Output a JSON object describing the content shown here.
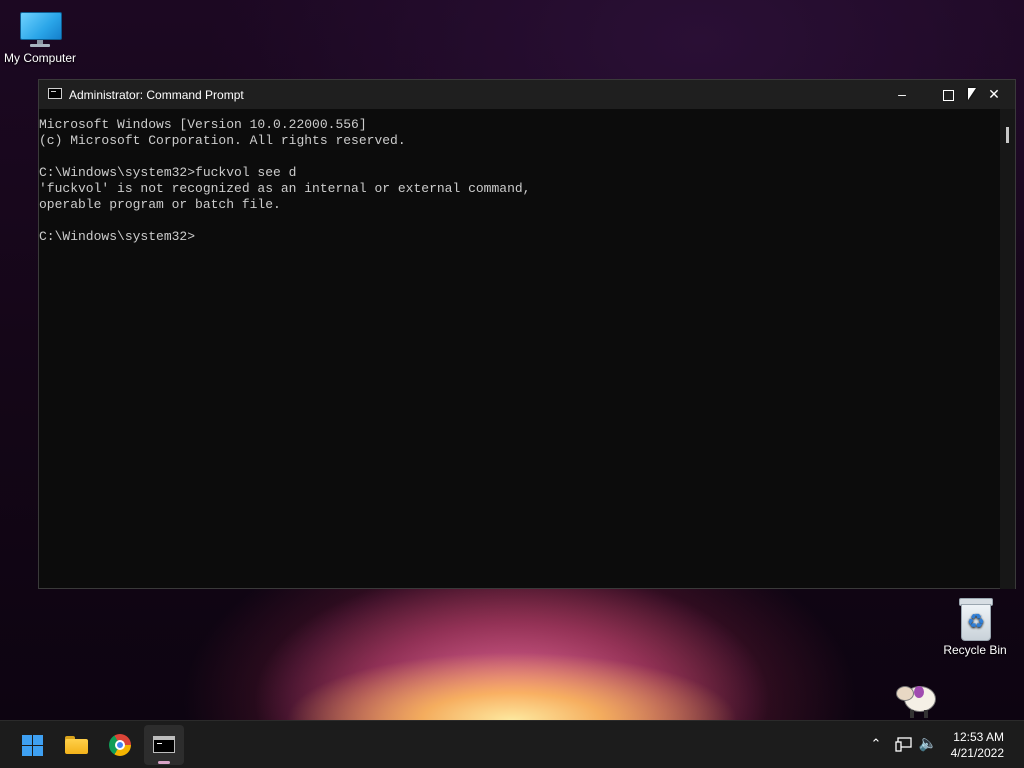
{
  "desktop": {
    "icons": [
      {
        "label": "My Computer"
      },
      {
        "label": "Recycle Bin"
      }
    ]
  },
  "window": {
    "title": "Administrator: Command Prompt",
    "controls": {
      "minimize": "–",
      "close": "✕"
    },
    "console_lines": [
      "Microsoft Windows [Version 10.0.22000.556]",
      "(c) Microsoft Corporation. All rights reserved.",
      "",
      "C:\\Windows\\system32>fuckvol see d",
      "'fuckvol' is not recognized as an internal or external command,",
      "operable program or batch file.",
      "",
      "C:\\Windows\\system32>"
    ]
  },
  "taskbar": {
    "apps": [
      "windows-start",
      "file-explorer",
      "chrome",
      "command-prompt"
    ],
    "tray": {
      "chevron": "⌃",
      "volume": "🔈"
    },
    "clock": {
      "time": "12:53 AM",
      "date": "4/21/2022"
    }
  },
  "colors": {
    "accent": "#3ea0f2",
    "console_bg": "#0c0c0c",
    "console_text": "#cccccc",
    "taskbar_bg": "#1c1c1c"
  }
}
